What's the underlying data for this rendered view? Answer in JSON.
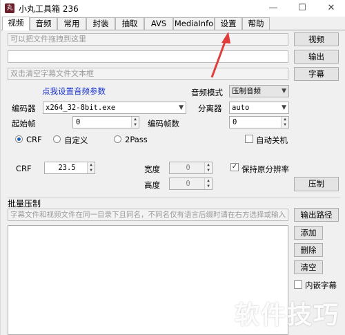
{
  "window": {
    "title": "小丸工具箱 236",
    "icon_text": "丸"
  },
  "window_controls": {
    "minimize": "—",
    "maximize": "☐",
    "close": "✕"
  },
  "tabs": [
    {
      "label": "视频",
      "active": true
    },
    {
      "label": "音频",
      "active": false
    },
    {
      "label": "常用",
      "active": false
    },
    {
      "label": "封装",
      "active": false
    },
    {
      "label": "抽取",
      "active": false
    },
    {
      "label": "AVS",
      "active": false
    },
    {
      "label": "MediaInfo",
      "active": false
    },
    {
      "label": "设置",
      "active": false
    },
    {
      "label": "帮助",
      "active": false
    }
  ],
  "video": {
    "drop_placeholder": "可以把文件拖拽到这里",
    "output_value": "",
    "subtitle_placeholder": "双击清空字幕文件文本框",
    "video_button": "视频",
    "output_button": "输出",
    "subtitle_button": "字幕",
    "audio_settings_link": "点我设置音频参数",
    "audio_mode_label": "音频模式",
    "audio_mode_value": "压制音频",
    "encoder_label": "编码器",
    "encoder_value": "x264_32-8bit.exe",
    "demuxer_label": "分离器",
    "demuxer_value": "auto",
    "start_frame_label": "起始帧",
    "start_frame_value": "0",
    "encode_frames_label": "编码帧数",
    "encode_frames_value": "0",
    "mode_crf": "CRF",
    "mode_custom": "自定义",
    "mode_2pass": "2Pass",
    "auto_shutdown": "自动关机",
    "crf_label": "CRF",
    "crf_value": "23.5",
    "width_label": "宽度",
    "width_value": "0",
    "height_label": "高度",
    "height_value": "0",
    "keep_resolution": "保持原分辨率",
    "encode_button": "压制"
  },
  "batch": {
    "title": "批量压制",
    "hint_placeholder": "字幕文件和视频文件在同一目录下且同名，不同名仅有语言后缀时请在右方选择或输入",
    "output_path_button": "输出路径",
    "add_button": "添加",
    "delete_button": "删除",
    "clear_button": "清空",
    "embed_subtitle": "内嵌字幕"
  },
  "watermark": "软件技巧",
  "colors": {
    "arrow": "#e23b3b",
    "link": "#1a33cc",
    "radio_dot": "#1e5dbb",
    "icon_bg": "#6b1f2a"
  }
}
